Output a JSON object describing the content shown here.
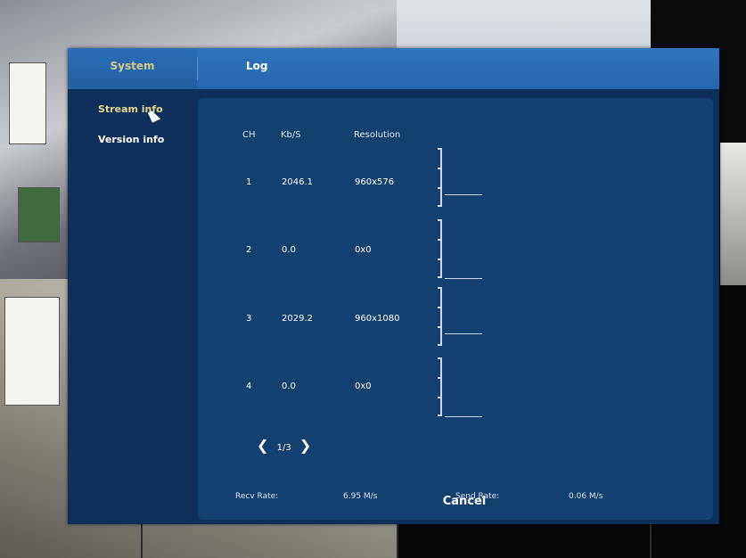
{
  "tabs": {
    "system": "System",
    "log": "Log"
  },
  "sidebar": {
    "stream_info": "Stream info",
    "version_info": "Version info"
  },
  "table": {
    "headers": {
      "ch": "CH",
      "kbs": "Kb/S",
      "resolution": "Resolution"
    },
    "rows": [
      {
        "ch": "1",
        "kbs": "2046.1",
        "resolution": "960x576"
      },
      {
        "ch": "2",
        "kbs": "0.0",
        "resolution": "0x0"
      },
      {
        "ch": "3",
        "kbs": "2029.2",
        "resolution": "960x1080"
      },
      {
        "ch": "4",
        "kbs": "0.0",
        "resolution": "0x0"
      }
    ]
  },
  "pager": {
    "label": "1/3"
  },
  "rates": {
    "recv_label": "Recv Rate:",
    "recv_value": "6.95 M/s",
    "send_label": "Send Rate:",
    "send_value": "0.06 M/s"
  },
  "cancel_label": "Cancel",
  "colors": {
    "dialog_bg": "#0d2f5a",
    "tabbar": "#2f76be",
    "panel": "#13406f",
    "active_text": "#d3c986"
  }
}
